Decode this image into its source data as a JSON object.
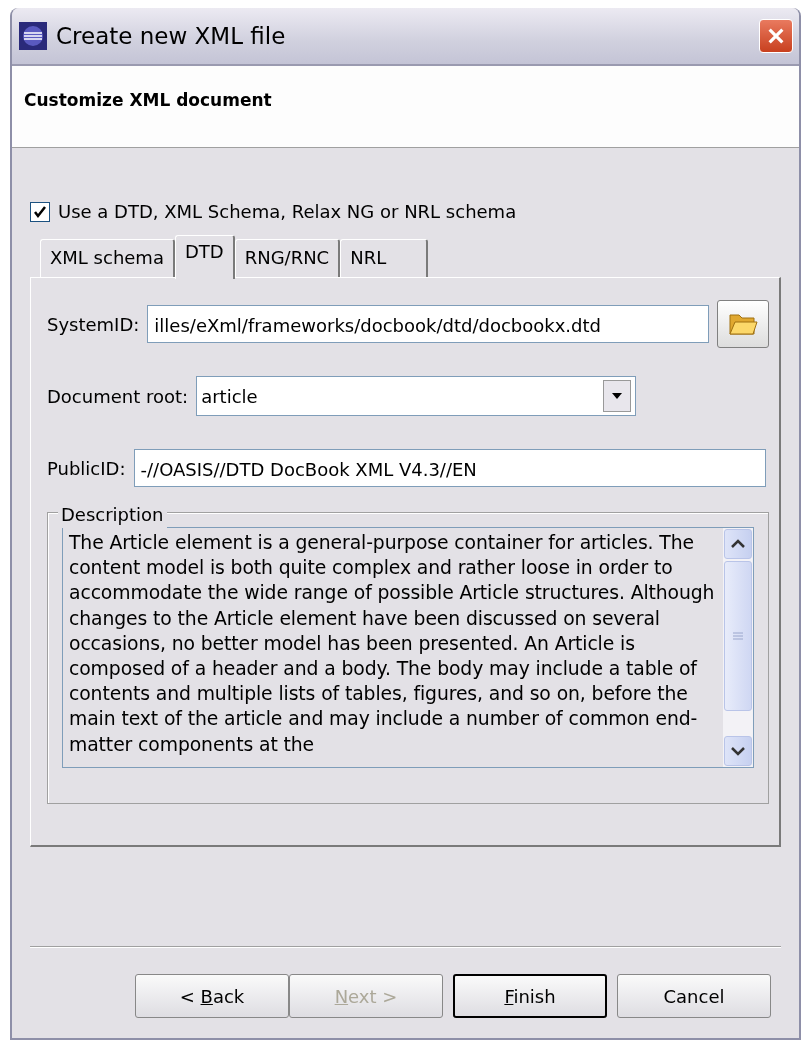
{
  "window": {
    "title": "Create new XML file"
  },
  "header": {
    "title": "Customize XML document"
  },
  "schema_checkbox": {
    "label": "Use a DTD, XML Schema, Relax NG or NRL schema",
    "checked": true
  },
  "tabs": [
    {
      "label": "XML schema",
      "selected": false
    },
    {
      "label": "DTD",
      "selected": true
    },
    {
      "label": "RNG/RNC",
      "selected": false
    },
    {
      "label": "NRL",
      "selected": false
    }
  ],
  "fields": [
    {
      "kind": "browse",
      "label": "SystemID:",
      "value": "illes/eXml/frameworks/docbook/dtd/docbookx.dtd"
    },
    {
      "kind": "combo",
      "label": "Document root:",
      "value": "article"
    },
    {
      "kind": "text",
      "label": "PublicID:",
      "value": "-//OASIS//DTD DocBook XML V4.3//EN"
    }
  ],
  "description": {
    "title": "Description",
    "text": "The Article element is a general-purpose container for articles. The content model is both quite complex and rather loose in order to accommodate the wide range of possible Article structures. Although changes to the Article element have been discussed on several occasions, no better model has been presented. An Article is composed of a header and a body. The body may include a table of contents and multiple lists of tables, figures, and so on, before the main text of the article and may include a number of common end-matter components at the"
  },
  "buttons": [
    {
      "before": "< ",
      "mnemonic": "B",
      "after": "ack",
      "disabled": false,
      "default": false
    },
    {
      "mnemonic": "N",
      "after": "ext >",
      "disabled": true,
      "default": false
    },
    {
      "mnemonic": "F",
      "after": "inish",
      "disabled": false,
      "default": true
    },
    {
      "after": "Cancel",
      "disabled": false,
      "default": false
    }
  ]
}
